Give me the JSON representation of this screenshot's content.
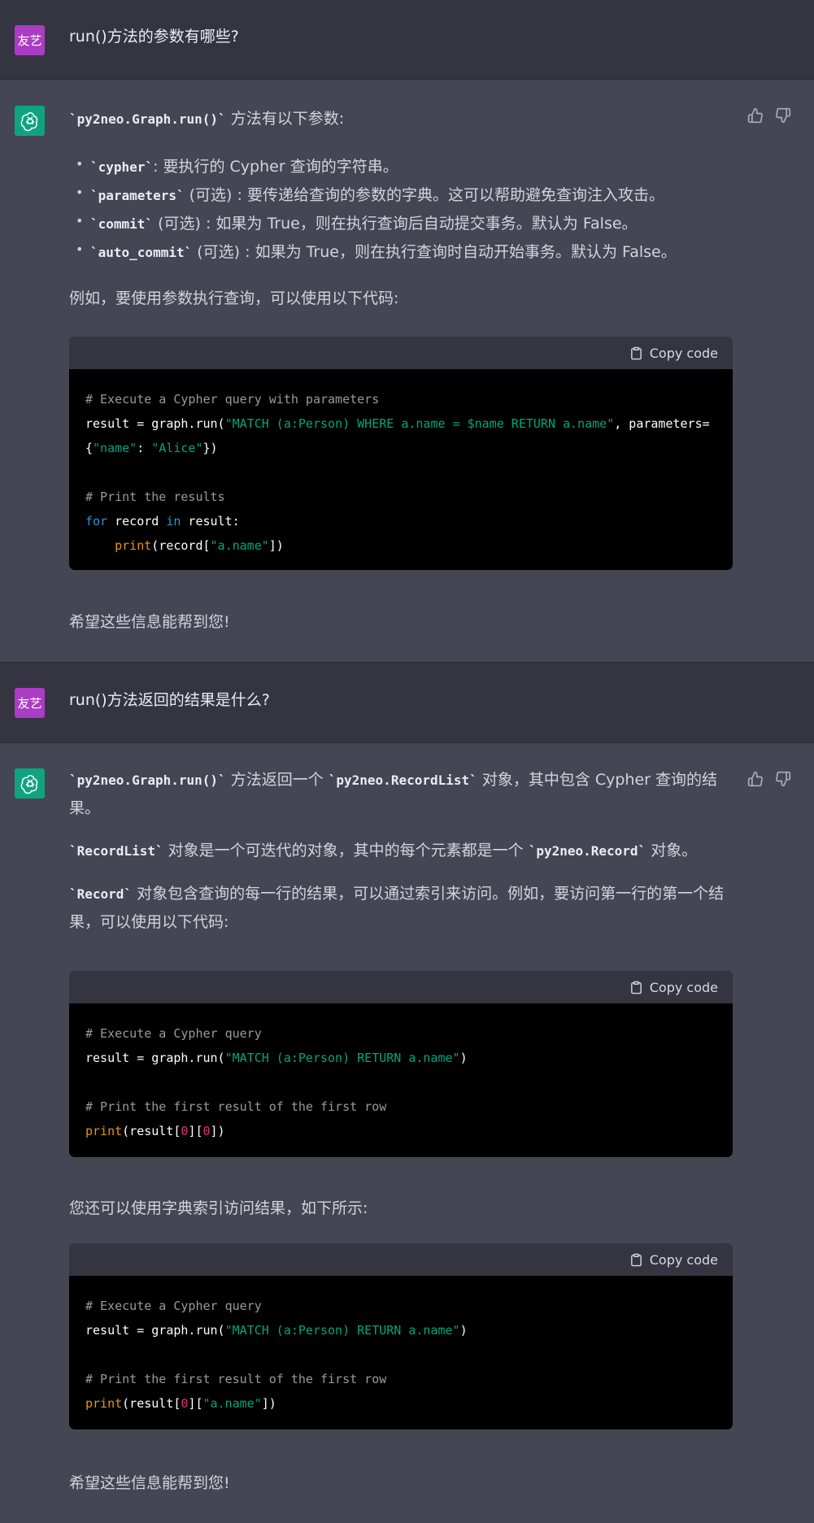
{
  "user_avatar_label": "友艺",
  "copy_code_label": "Copy code",
  "turns": {
    "q1": {
      "text": "run()方法的参数有哪些?"
    },
    "a1": {
      "intro_code": "`py2neo.Graph.run()`",
      "intro_text": " 方法有以下参数:",
      "params": [
        {
          "name": "`cypher`",
          "desc": ": 要执行的 Cypher 查询的字符串。"
        },
        {
          "name": "`parameters`",
          "desc": " (可选) : 要传递给查询的参数的字典。这可以帮助避免查询注入攻击。"
        },
        {
          "name": "`commit`",
          "desc": " (可选) : 如果为 True，则在执行查询后自动提交事务。默认为 False。"
        },
        {
          "name": "`auto_commit`",
          "desc": " (可选) : 如果为 True，则在执行查询时自动开始事务。默认为 False。"
        }
      ],
      "example_text": "例如，要使用参数执行查询，可以使用以下代码:",
      "code": {
        "comment1": "# Execute a Cypher query with parameters",
        "line2a": "result = graph.run(",
        "line2b": "\"MATCH (a:Person) WHERE a.name = $name RETURN a.name\"",
        "line2c": ", parameters=",
        "line3a": "{",
        "line3b": "\"name\"",
        "line3c": ": ",
        "line3d": "\"Alice\"",
        "line3e": "})",
        "comment2": "# Print the results",
        "line5a": "for",
        "line5b": " record ",
        "line5c": "in",
        "line5d": " result:",
        "line6a": "    ",
        "line6b": "print",
        "line6c": "(record[",
        "line6d": "\"a.name\"",
        "line6e": "])"
      },
      "closing": "希望这些信息能帮到您!"
    },
    "q2": {
      "text": "run()方法返回的结果是什么?"
    },
    "a2": {
      "p1_code1": "`py2neo.Graph.run()`",
      "p1_text1": " 方法返回一个 ",
      "p1_code2": "`py2neo.RecordList`",
      "p1_text2": " 对象，其中包含 Cypher 查询的结果。",
      "p2_code1": "`RecordList`",
      "p2_text1": " 对象是一个可迭代的对象，其中的每个元素都是一个 ",
      "p2_code2": "`py2neo.Record`",
      "p2_text2": " 对象。",
      "p3_code1": "`Record`",
      "p3_text1": " 对象包含查询的每一行的结果，可以通过索引来访问。例如，要访问第一行的第一个结果，可以使用以下代码:",
      "code1": {
        "comment1": "# Execute a Cypher query",
        "line2a": "result = graph.run(",
        "line2b": "\"MATCH (a:Person) RETURN a.name\"",
        "line2c": ")",
        "comment2": "# Print the first result of the first row",
        "line5a": "print",
        "line5b": "(result[",
        "line5c": "0",
        "line5d": "][",
        "line5e": "0",
        "line5f": "])"
      },
      "dict_text": "您还可以使用字典索引访问结果，如下所示:",
      "code2": {
        "comment1": "# Execute a Cypher query",
        "line2a": "result = graph.run(",
        "line2b": "\"MATCH (a:Person) RETURN a.name\"",
        "line2c": ")",
        "comment2": "# Print the first result of the first row",
        "line5a": "print",
        "line5b": "(result[",
        "line5c": "0",
        "line5d": "][",
        "line5e": "\"a.name\"",
        "line5f": "])"
      },
      "closing": "希望这些信息能帮到您!"
    }
  },
  "icons": {
    "bot": "openai-logo-icon",
    "copy": "clipboard-icon",
    "like": "thumbs-up-icon",
    "dislike": "thumbs-down-icon"
  },
  "colors": {
    "user_bg": "#343541",
    "assistant_bg": "#444654",
    "user_avatar": "#ab3cc4",
    "bot_avatar": "#10a37f",
    "code_string": "#00a67d",
    "code_keyword": "#2e95d3",
    "code_builtin": "#e9950c",
    "code_number": "#df3079"
  }
}
